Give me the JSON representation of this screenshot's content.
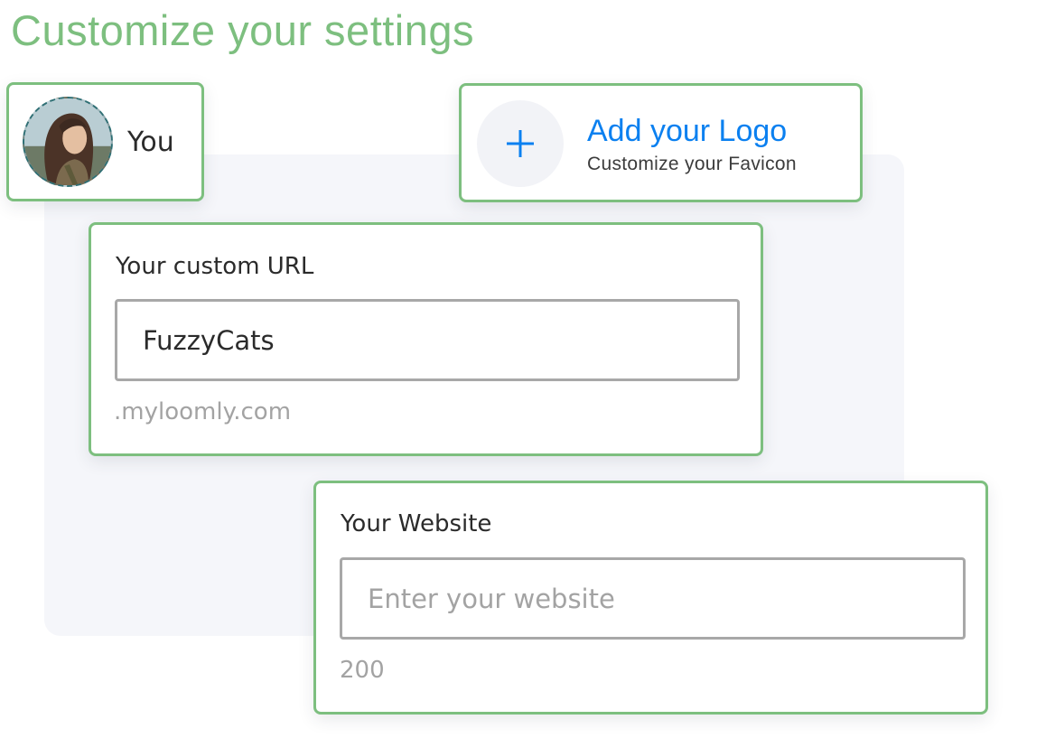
{
  "page": {
    "title": "Customize your settings"
  },
  "profile": {
    "name": "You",
    "avatar_icon": "user-avatar-photo"
  },
  "logo": {
    "add_icon": "plus-icon",
    "title": "Add your Logo",
    "subtitle": "Customize your Favicon"
  },
  "custom_url": {
    "label": "Your custom URL",
    "value": "FuzzyCats",
    "suffix": ".myloomly.com"
  },
  "website": {
    "label": "Your Website",
    "placeholder": "Enter your website",
    "value": "",
    "char_limit": "200"
  },
  "colors": {
    "accent_green": "#7dbf7f",
    "link_blue": "#0b80f0",
    "input_border": "#a8a8a8",
    "backdrop": "#f5f6fa"
  }
}
